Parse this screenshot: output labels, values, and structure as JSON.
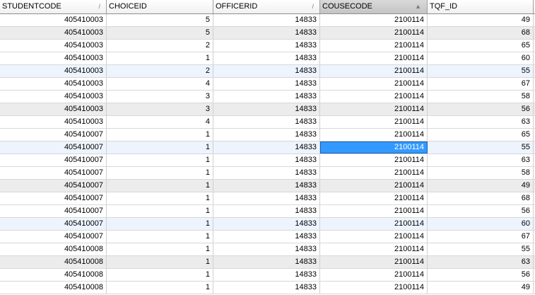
{
  "columns": [
    {
      "label": "STUDENTCODE",
      "sort_icon": "/",
      "sorted": false
    },
    {
      "label": "CHOICEID",
      "sort_icon": "",
      "sorted": false
    },
    {
      "label": "OFFICERID",
      "sort_icon": "/",
      "sorted": false
    },
    {
      "label": "COUSECODE",
      "sort_icon": "▲",
      "sorted": true
    },
    {
      "label": "TQF_ID",
      "sort_icon": "",
      "sorted": false
    }
  ],
  "rows": [
    {
      "cells": [
        "405410003",
        "5",
        "14833",
        "2100114",
        "49"
      ],
      "shade": "white"
    },
    {
      "cells": [
        "405410003",
        "5",
        "14833",
        "2100114",
        "68"
      ],
      "shade": "gray"
    },
    {
      "cells": [
        "405410003",
        "2",
        "14833",
        "2100114",
        "65"
      ],
      "shade": "white"
    },
    {
      "cells": [
        "405410003",
        "1",
        "14833",
        "2100114",
        "60"
      ],
      "shade": "white"
    },
    {
      "cells": [
        "405410003",
        "2",
        "14833",
        "2100114",
        "55"
      ],
      "shade": "blue"
    },
    {
      "cells": [
        "405410003",
        "4",
        "14833",
        "2100114",
        "67"
      ],
      "shade": "white"
    },
    {
      "cells": [
        "405410003",
        "3",
        "14833",
        "2100114",
        "58"
      ],
      "shade": "white"
    },
    {
      "cells": [
        "405410003",
        "3",
        "14833",
        "2100114",
        "56"
      ],
      "shade": "gray"
    },
    {
      "cells": [
        "405410003",
        "4",
        "14833",
        "2100114",
        "63"
      ],
      "shade": "white"
    },
    {
      "cells": [
        "405410007",
        "1",
        "14833",
        "2100114",
        "65"
      ],
      "shade": "white"
    },
    {
      "cells": [
        "405410007",
        "1",
        "14833",
        "2100114",
        "55"
      ],
      "shade": "blue",
      "selected_col": 3
    },
    {
      "cells": [
        "405410007",
        "1",
        "14833",
        "2100114",
        "63"
      ],
      "shade": "white"
    },
    {
      "cells": [
        "405410007",
        "1",
        "14833",
        "2100114",
        "58"
      ],
      "shade": "white"
    },
    {
      "cells": [
        "405410007",
        "1",
        "14833",
        "2100114",
        "49"
      ],
      "shade": "gray"
    },
    {
      "cells": [
        "405410007",
        "1",
        "14833",
        "2100114",
        "68"
      ],
      "shade": "white"
    },
    {
      "cells": [
        "405410007",
        "1",
        "14833",
        "2100114",
        "56"
      ],
      "shade": "white"
    },
    {
      "cells": [
        "405410007",
        "1",
        "14833",
        "2100114",
        "60"
      ],
      "shade": "blue"
    },
    {
      "cells": [
        "405410007",
        "1",
        "14833",
        "2100114",
        "67"
      ],
      "shade": "white"
    },
    {
      "cells": [
        "405410008",
        "1",
        "14833",
        "2100114",
        "55"
      ],
      "shade": "white"
    },
    {
      "cells": [
        "405410008",
        "1",
        "14833",
        "2100114",
        "63"
      ],
      "shade": "gray"
    },
    {
      "cells": [
        "405410008",
        "1",
        "14833",
        "2100114",
        "56"
      ],
      "shade": "white"
    },
    {
      "cells": [
        "405410008",
        "1",
        "14833",
        "2100114",
        "49"
      ],
      "shade": "white"
    }
  ],
  "colors": {
    "selected_cell": "#3399ff",
    "row_gray": "#ececec",
    "row_blue": "#edf4fd",
    "sorted_header": "#c4c4c4"
  }
}
